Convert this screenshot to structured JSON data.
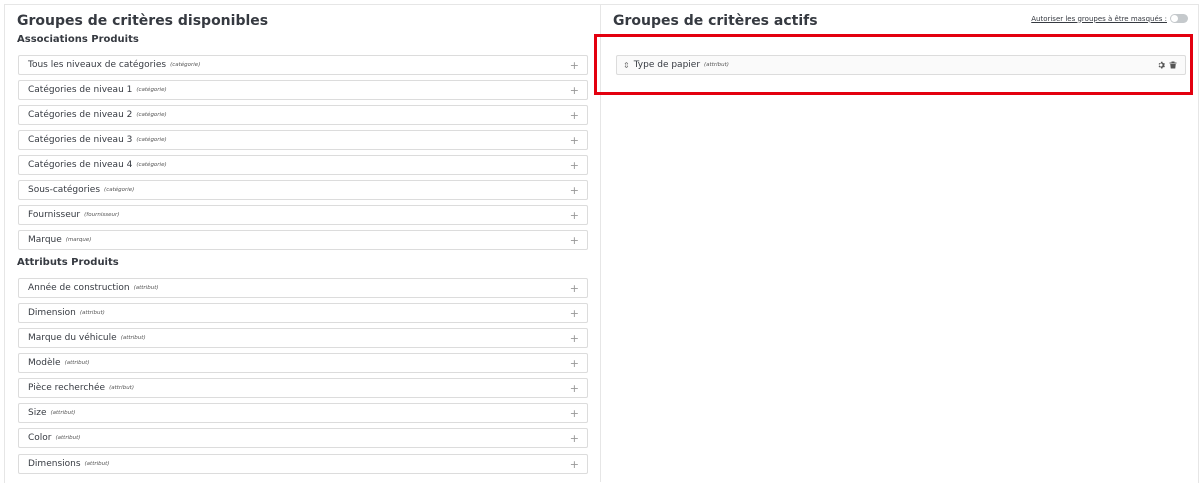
{
  "available": {
    "title": "Groupes de critères disponibles",
    "sections": [
      {
        "title": "Associations Produits",
        "items": [
          {
            "label": "Tous les niveaux de catégories",
            "type": "(catégorie)"
          },
          {
            "label": "Catégories de niveau 1",
            "type": "(catégorie)"
          },
          {
            "label": "Catégories de niveau 2",
            "type": "(catégorie)"
          },
          {
            "label": "Catégories de niveau 3",
            "type": "(catégorie)"
          },
          {
            "label": "Catégories de niveau 4",
            "type": "(catégorie)"
          },
          {
            "label": "Sous-catégories",
            "type": "(catégorie)"
          },
          {
            "label": "Fournisseur",
            "type": "(fournisseur)"
          },
          {
            "label": "Marque",
            "type": "(marque)"
          }
        ]
      },
      {
        "title": "Attributs Produits",
        "items": [
          {
            "label": "Année de construction",
            "type": "(attribut)"
          },
          {
            "label": "Dimension",
            "type": "(attribut)"
          },
          {
            "label": "Marque du véhicule",
            "type": "(attribut)"
          },
          {
            "label": "Modèle",
            "type": "(attribut)"
          },
          {
            "label": "Pièce recherchée",
            "type": "(attribut)"
          },
          {
            "label": "Size",
            "type": "(attribut)"
          },
          {
            "label": "Color",
            "type": "(attribut)"
          },
          {
            "label": "Dimensions",
            "type": "(attribut)"
          }
        ]
      }
    ],
    "add_symbol": "+"
  },
  "active": {
    "title": "Groupes de critères actifs",
    "toggle_label": "Autoriser les groupes à être masqués :",
    "toggle_on": false,
    "items": [
      {
        "label": "Type de papier",
        "type": "(attribut)"
      }
    ],
    "highlight_color": "#e3000f"
  }
}
